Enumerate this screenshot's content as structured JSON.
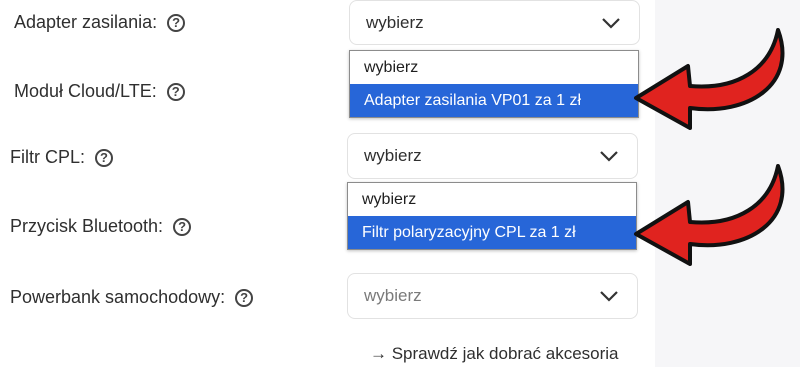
{
  "colors": {
    "accent": "#2766d8",
    "arrow": "#e0231f",
    "panel_bg": "#f6f6f8"
  },
  "fields": [
    {
      "label": "Adapter zasilania:",
      "value": "wybierz"
    },
    {
      "label": "Moduł Cloud/LTE:",
      "value": "wybierz"
    },
    {
      "label": "Filtr CPL:",
      "value": "wybierz"
    },
    {
      "label": "Przycisk Bluetooth:",
      "value": "wybierz"
    },
    {
      "label": "Powerbank samochodowy:",
      "value": "wybierz"
    }
  ],
  "help_glyph": "?",
  "dropdowns": [
    {
      "options": [
        "wybierz",
        "Adapter zasilania VP01 za 1 zł"
      ],
      "highlighted": 1
    },
    {
      "options": [
        "wybierz",
        "Filtr polaryzacyjny CPL za 1 zł"
      ],
      "highlighted": 1
    }
  ],
  "link_text": "→ Sprawdź jak dobrać akcesoria",
  "icons": {
    "help": "question-circle-icon",
    "chevron": "chevron-down-icon",
    "pointer": "red-arrow-icon"
  }
}
